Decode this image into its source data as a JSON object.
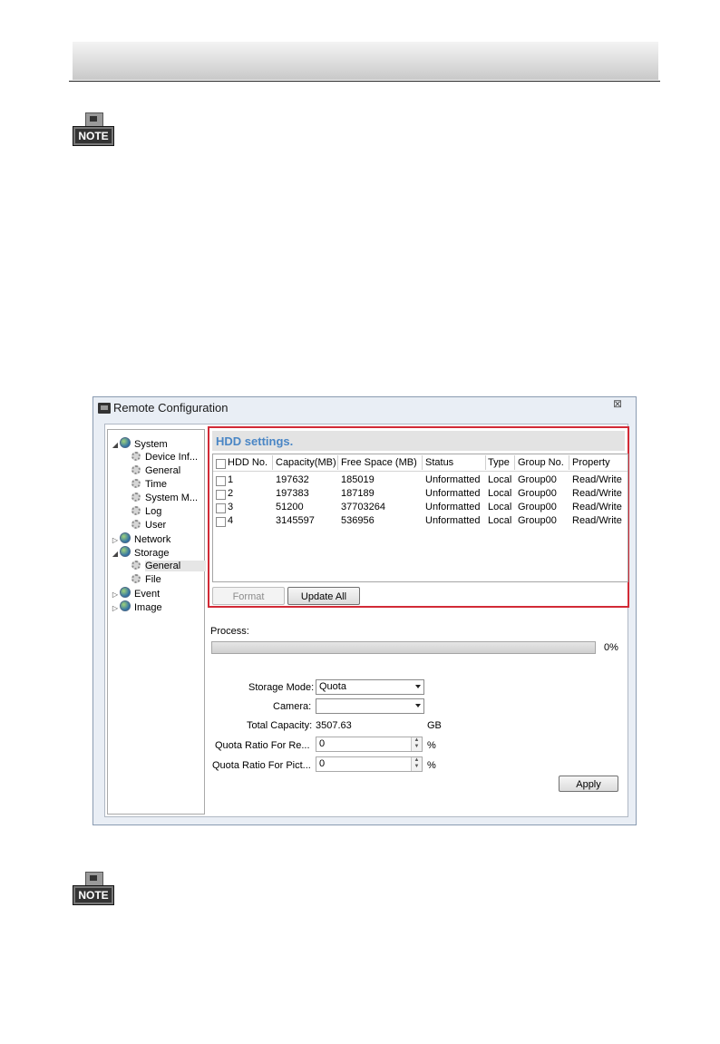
{
  "document": {
    "note_label": "NOTE"
  },
  "window": {
    "title": "Remote Configuration",
    "close_glyph": "⊠"
  },
  "tree": {
    "items": [
      {
        "label": "System",
        "icon": "globe-icon",
        "expander": "◢"
      },
      {
        "label": "Device Inf...",
        "icon": "gear-icon"
      },
      {
        "label": "General",
        "icon": "gear-icon"
      },
      {
        "label": "Time",
        "icon": "gear-icon"
      },
      {
        "label": "System M...",
        "icon": "gear-icon"
      },
      {
        "label": "Log",
        "icon": "gear-icon"
      },
      {
        "label": "User",
        "icon": "gear-icon"
      },
      {
        "label": "Network",
        "icon": "globe-icon",
        "expander": "▷"
      },
      {
        "label": "Storage",
        "icon": "globe-icon",
        "expander": "◢"
      },
      {
        "label": "General",
        "icon": "gear-icon",
        "selected": true
      },
      {
        "label": "File",
        "icon": "gear-icon"
      },
      {
        "label": "Event",
        "icon": "globe-icon",
        "expander": "▷"
      },
      {
        "label": "Image",
        "icon": "globe-icon",
        "expander": "▷"
      }
    ]
  },
  "hdd": {
    "title": "HDD settings.",
    "columns": [
      "HDD No.",
      "Capacity(MB)",
      "Free Space (MB)",
      "Status",
      "Type",
      "Group No.",
      "Property"
    ],
    "rows": [
      {
        "no": "1",
        "capacity": "197632",
        "free": "185019",
        "status": "Unformatted",
        "type": "Local",
        "group": "Group00",
        "property": "Read/Write"
      },
      {
        "no": "2",
        "capacity": "197383",
        "free": "187189",
        "status": "Unformatted",
        "type": "Local",
        "group": "Group00",
        "property": "Read/Write"
      },
      {
        "no": "3",
        "capacity": "51200",
        "free": "37703264",
        "status": "Unformatted",
        "type": "Local",
        "group": "Group00",
        "property": "Read/Write"
      },
      {
        "no": "4",
        "capacity": "3145597",
        "free": "536956",
        "status": "Unformatted",
        "type": "Local",
        "group": "Group00",
        "property": "Read/Write"
      }
    ],
    "format_label": "Format",
    "update_all_label": "Update All"
  },
  "process": {
    "label": "Process:",
    "percent_text": "0%",
    "progress": 0
  },
  "form": {
    "storage_mode_label": "Storage Mode:",
    "storage_mode_value": "Quota",
    "camera_label": "Camera:",
    "camera_value": "",
    "total_capacity_label": "Total Capacity:",
    "total_capacity_value": "3507.63",
    "total_capacity_unit": "GB",
    "quota_record_label": "Quota Ratio For Re...",
    "quota_record_value": "0",
    "quota_picture_label": "Quota Ratio For Pict...",
    "quota_picture_value": "0",
    "percent_unit": "%",
    "apply_label": "Apply"
  }
}
